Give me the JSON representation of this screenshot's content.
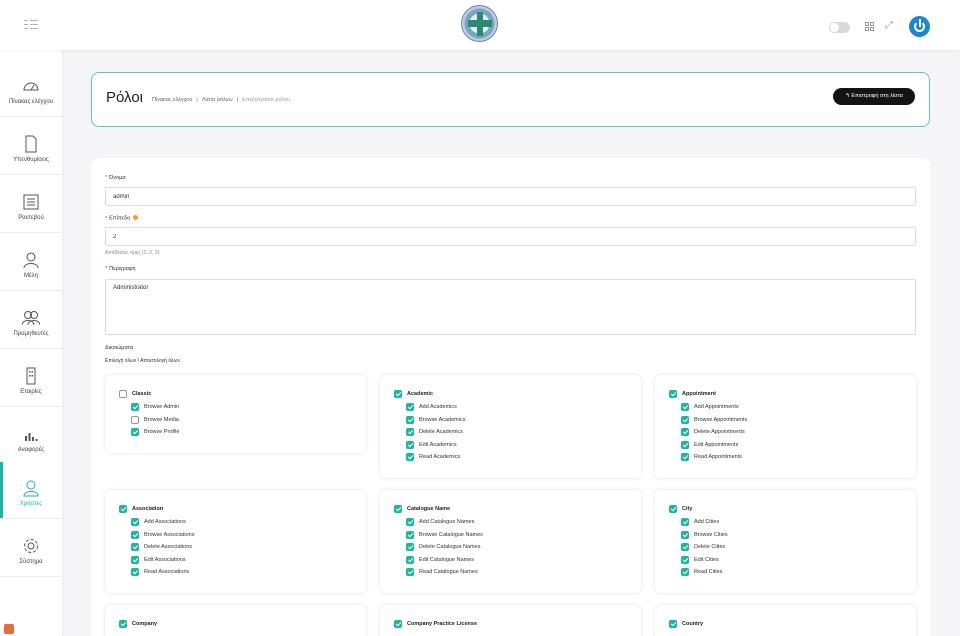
{
  "sidebar": {
    "items": [
      {
        "label": "Πίνακας ελέγχου",
        "icon": "dashboard-icon"
      },
      {
        "label": "Υπενθυμίσεις",
        "icon": "document-icon"
      },
      {
        "label": "Ραντεβού",
        "icon": "calendar-icon"
      },
      {
        "label": "Μέλη",
        "icon": "user-icon"
      },
      {
        "label": "Προμηθευτές",
        "icon": "users-icon"
      },
      {
        "label": "Εταιρίες",
        "icon": "building-icon"
      },
      {
        "label": "Αναφορές",
        "icon": "chart-icon"
      },
      {
        "label": "Χρήστες",
        "icon": "user-check-icon",
        "active": true
      },
      {
        "label": "Σύστημα",
        "icon": "gear-icon"
      }
    ]
  },
  "header": {
    "title": "Ρόλοι",
    "breadcrumb": [
      "Πίνακας ελέγχου",
      "Λίστα ρόλων",
      "Επεξεργασία ρόλου"
    ],
    "back_button": "↰ Επιστροφή στη λίστα"
  },
  "form": {
    "name_label": "Όνομα",
    "name_value": "admin",
    "level_label": "Επίπεδο",
    "level_value": "2",
    "level_hint": "Αποδεκτές τιμές (1, 2, 3)",
    "description_label": "Περιγραφή",
    "description_value": "Administrator",
    "permissions_label": "Δικαιώματα",
    "select_all": "Επιλογή όλων / Αποεπιλογή όλων"
  },
  "groups": [
    {
      "name": "Classic",
      "checked": false,
      "perms": [
        {
          "label": "Browse Admin",
          "checked": true
        },
        {
          "label": "Browse Media",
          "checked": false
        },
        {
          "label": "Browse Profile",
          "checked": true
        }
      ]
    },
    {
      "name": "Academic",
      "checked": true,
      "perms": [
        {
          "label": "Add Academics",
          "checked": true
        },
        {
          "label": "Browse Academics",
          "checked": true
        },
        {
          "label": "Delete Academics",
          "checked": true
        },
        {
          "label": "Edit Academics",
          "checked": true
        },
        {
          "label": "Read Academics",
          "checked": true
        }
      ]
    },
    {
      "name": "Appointment",
      "checked": true,
      "perms": [
        {
          "label": "Add Appointments",
          "checked": true
        },
        {
          "label": "Browse Appointments",
          "checked": true
        },
        {
          "label": "Delete Appointments",
          "checked": true
        },
        {
          "label": "Edit Appointments",
          "checked": true
        },
        {
          "label": "Read Appointments",
          "checked": true
        }
      ]
    },
    {
      "name": "Association",
      "checked": true,
      "perms": [
        {
          "label": "Add Associations",
          "checked": true
        },
        {
          "label": "Browse Associations",
          "checked": true
        },
        {
          "label": "Delete Associations",
          "checked": true
        },
        {
          "label": "Edit Associations",
          "checked": true
        },
        {
          "label": "Read Associations",
          "checked": true
        }
      ]
    },
    {
      "name": "Catalogue Name",
      "checked": true,
      "perms": [
        {
          "label": "Add Catalogue Names",
          "checked": true
        },
        {
          "label": "Browse Catalogue Names",
          "checked": true
        },
        {
          "label": "Delete Catalogue Names",
          "checked": true
        },
        {
          "label": "Edit Catalogue Names",
          "checked": true
        },
        {
          "label": "Read Catalogue Names",
          "checked": true
        }
      ]
    },
    {
      "name": "City",
      "checked": true,
      "perms": [
        {
          "label": "Add Cities",
          "checked": true
        },
        {
          "label": "Browse Cities",
          "checked": true
        },
        {
          "label": "Delete Cities",
          "checked": true
        },
        {
          "label": "Edit Cities",
          "checked": true
        },
        {
          "label": "Read Cities",
          "checked": true
        }
      ]
    },
    {
      "name": "Company",
      "checked": true,
      "perms": []
    },
    {
      "name": "Company Practice License",
      "checked": true,
      "perms": []
    },
    {
      "name": "Country",
      "checked": true,
      "perms": []
    }
  ],
  "colors": {
    "accent": "#1fb5a0",
    "primary": "#1e88c7",
    "required": "#d82c2c"
  }
}
